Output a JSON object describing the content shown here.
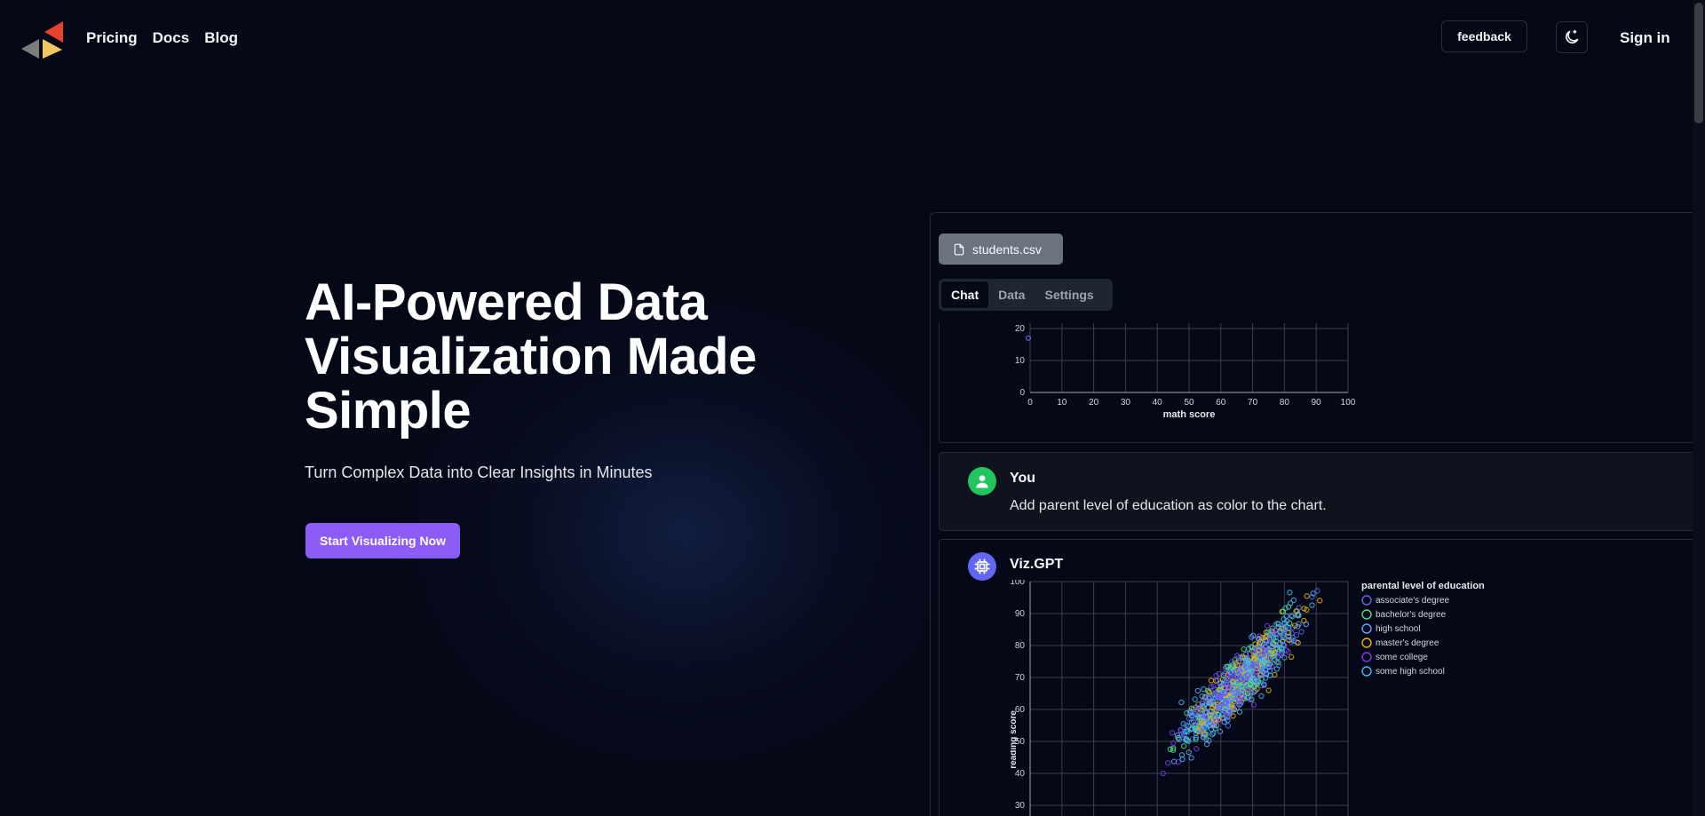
{
  "nav": {
    "links": [
      "Pricing",
      "Docs",
      "Blog"
    ],
    "feedback_label": "feedback",
    "signin_label": "Sign in",
    "logo_colors": [
      "#e8412c",
      "#f0c75e",
      "#7c7c7c"
    ]
  },
  "hero": {
    "title": "AI-Powered Data Visualization Made Simple",
    "subtitle": "Turn Complex Data into Clear Insights in Minutes",
    "cta_label": "Start Visualizing Now",
    "cta_color": "#8b5cf6"
  },
  "app": {
    "file_name": "students.csv",
    "tabs": [
      {
        "label": "Chat",
        "active": true
      },
      {
        "label": "Data",
        "active": false
      },
      {
        "label": "Settings",
        "active": false
      }
    ],
    "messages": [
      {
        "author": "You",
        "text": "Add parent level of education as color to the chart.",
        "avatar_color": "#22c55e",
        "avatar_icon": "user-icon"
      },
      {
        "author": "Viz.GPT",
        "avatar_color": "#6366f1",
        "avatar_icon": "chip-icon"
      }
    ]
  },
  "chart_data": [
    {
      "type": "scatter",
      "xlabel": "math score",
      "ylabel": "",
      "xlim": [
        0,
        100
      ],
      "ylim_visible": [
        0,
        20
      ],
      "x_ticks": [
        0,
        10,
        20,
        30,
        40,
        50,
        60,
        70,
        80,
        90,
        100
      ],
      "y_ticks": [
        0,
        10,
        20
      ],
      "points": [
        [
          0,
          17
        ]
      ]
    },
    {
      "type": "scatter",
      "xlabel": "",
      "ylabel": "reading score",
      "xlim": [
        0,
        100
      ],
      "ylim": [
        30,
        100
      ],
      "y_ticks": [
        30,
        40,
        50,
        60,
        70,
        80,
        90,
        100
      ],
      "legend_title": "parental level of education",
      "legend_position": "right",
      "series": [
        {
          "name": "associate's degree",
          "color": "#6366f1"
        },
        {
          "name": "bachelor's degree",
          "color": "#4ade80"
        },
        {
          "name": "high school",
          "color": "#60a5fa"
        },
        {
          "name": "master's degree",
          "color": "#eab308"
        },
        {
          "name": "some college",
          "color": "#7c3aed"
        },
        {
          "name": "some high school",
          "color": "#38bdf8"
        }
      ]
    }
  ]
}
